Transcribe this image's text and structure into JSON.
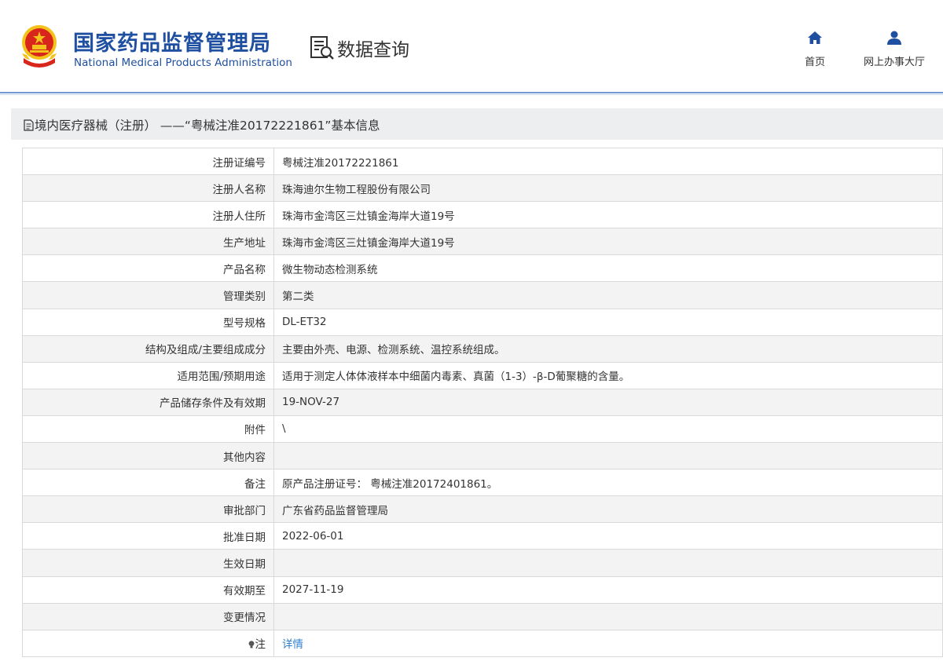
{
  "header": {
    "org_cn": "国家药品监督管理局",
    "org_en": "National Medical Products Administration",
    "data_query": "数据查询",
    "nav": {
      "home": "首页",
      "online_hall": "网上办事大厅"
    }
  },
  "panel": {
    "title": "境内医疗器械（注册） ——“粤械注准20172221861”基本信息"
  },
  "rows": [
    {
      "label": "注册证编号",
      "value": "粤械注准20172221861"
    },
    {
      "label": "注册人名称",
      "value": "珠海迪尔生物工程股份有限公司"
    },
    {
      "label": "注册人住所",
      "value": "珠海市金湾区三灶镇金海岸大道19号"
    },
    {
      "label": "生产地址",
      "value": "珠海市金湾区三灶镇金海岸大道19号"
    },
    {
      "label": "产品名称",
      "value": "微生物动态检测系统"
    },
    {
      "label": "管理类别",
      "value": "第二类"
    },
    {
      "label": "型号规格",
      "value": "DL-ET32"
    },
    {
      "label": "结构及组成/主要组成成分",
      "value": "主要由外壳、电源、检测系统、温控系统组成。"
    },
    {
      "label": "适用范围/预期用途",
      "value": "适用于测定人体体液样本中细菌内毒素、真菌（1-3）-β-D葡聚糖的含量。"
    },
    {
      "label": "产品储存条件及有效期",
      "value": "19-NOV-27"
    },
    {
      "label": "附件",
      "value": "\\"
    },
    {
      "label": "其他内容",
      "value": ""
    },
    {
      "label": "备注",
      "value": "原产品注册证号： 粤械注准20172401861。"
    },
    {
      "label": "审批部门",
      "value": "广东省药品监督管理局"
    },
    {
      "label": "批准日期",
      "value": "2022-06-01"
    },
    {
      "label": "生效日期",
      "value": ""
    },
    {
      "label": "有效期至",
      "value": "2027-11-19"
    },
    {
      "label": "变更情况",
      "value": ""
    }
  ],
  "note_row": {
    "label": "注",
    "link": "详情"
  },
  "colors": {
    "brand_blue": "#1f4fa0",
    "link_blue": "#2d7fd0",
    "emblem_red": "#d9261c",
    "emblem_gold": "#f3c31c"
  }
}
